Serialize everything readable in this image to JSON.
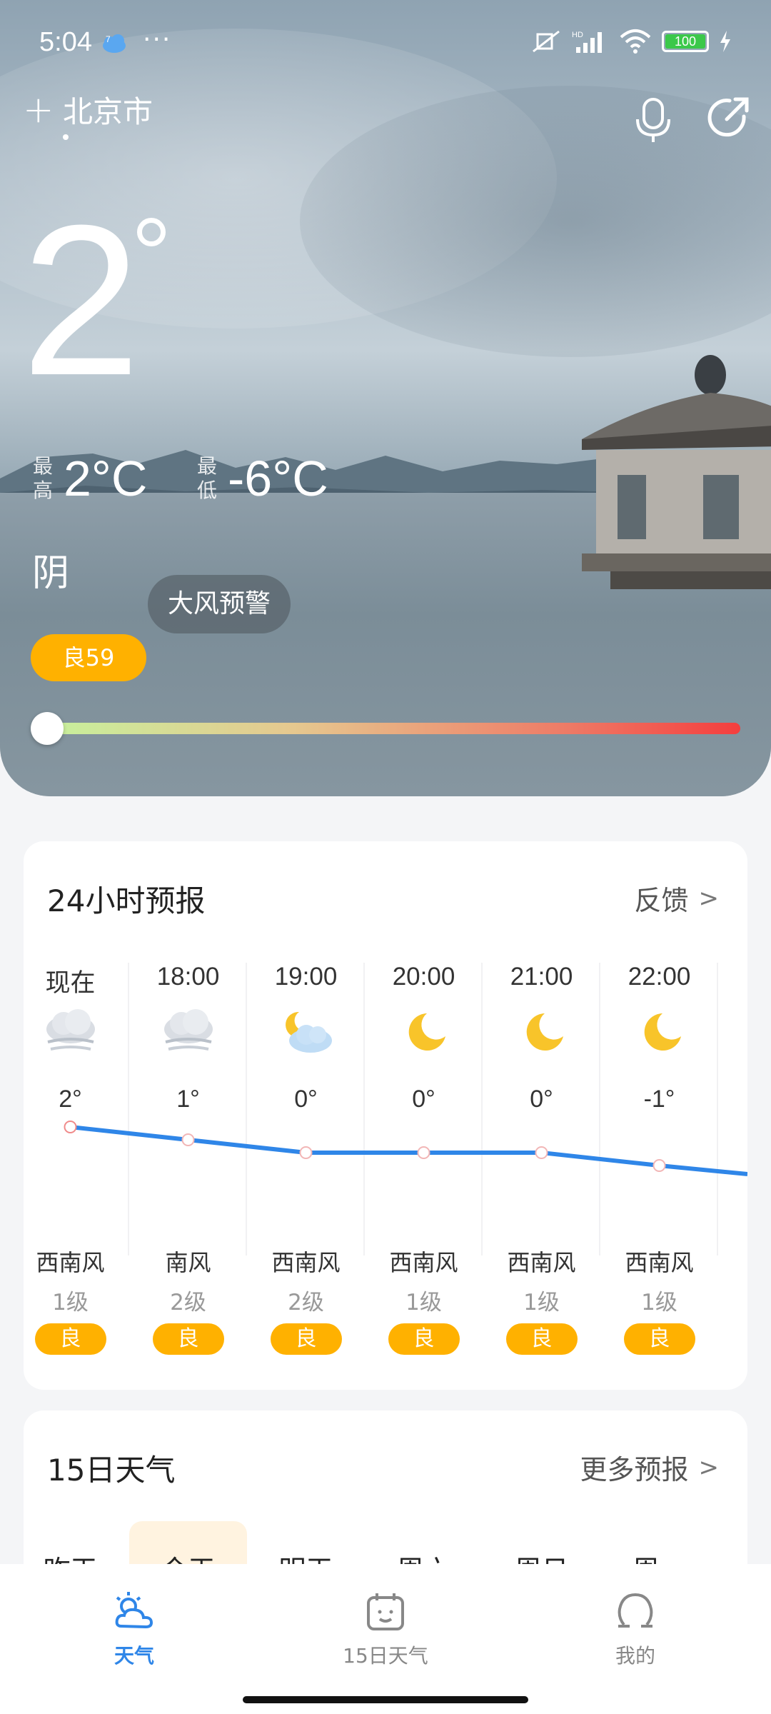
{
  "status_bar": {
    "time": "5:04",
    "notification_badge": "7",
    "battery": "100",
    "signal_label": "HD"
  },
  "header": {
    "city": "北京市"
  },
  "current": {
    "temperature": "2",
    "high_label": "最高",
    "high_value": "2°C",
    "low_label": "最低",
    "low_value": "-6°C",
    "condition": "阴",
    "alert": "大风预警",
    "aqi": "良59",
    "aqi_level": 0.02
  },
  "forecast24": {
    "title": "24小时预报",
    "feedback": "反馈",
    "hours": [
      {
        "time": "现在",
        "icon": "cloudy-fog-icon",
        "temp": "2°",
        "temp_value": 2,
        "wind_dir": "西南风",
        "wind_level": "1级",
        "quality": "良"
      },
      {
        "time": "18:00",
        "icon": "cloudy-fog-icon",
        "temp": "1°",
        "temp_value": 1,
        "wind_dir": "南风",
        "wind_level": "2级",
        "quality": "良"
      },
      {
        "time": "19:00",
        "icon": "partly-cloudy-night-icon",
        "temp": "0°",
        "temp_value": 0,
        "wind_dir": "西南风",
        "wind_level": "2级",
        "quality": "良"
      },
      {
        "time": "20:00",
        "icon": "moon-icon",
        "temp": "0°",
        "temp_value": 0,
        "wind_dir": "西南风",
        "wind_level": "1级",
        "quality": "良"
      },
      {
        "time": "21:00",
        "icon": "moon-icon",
        "temp": "0°",
        "temp_value": 0,
        "wind_dir": "西南风",
        "wind_level": "1级",
        "quality": "良"
      },
      {
        "time": "22:00",
        "icon": "moon-icon",
        "temp": "-1°",
        "temp_value": -1,
        "wind_dir": "西南风",
        "wind_level": "1级",
        "quality": "良"
      }
    ]
  },
  "forecast15": {
    "title": "15日天气",
    "more": "更多预报",
    "days": [
      "昨天",
      "今天",
      "明天",
      "周六",
      "周日",
      "周一"
    ]
  },
  "nav": {
    "items": [
      {
        "label": "天气",
        "icon": "weather-icon",
        "active": true
      },
      {
        "label": "15日天气",
        "icon": "calendar-icon",
        "active": false
      },
      {
        "label": "我的",
        "icon": "profile-icon",
        "active": false
      }
    ]
  },
  "colors": {
    "accent": "#2f86e8",
    "aqi_good": "#ffb100",
    "temp_line": "#2f86e8"
  }
}
